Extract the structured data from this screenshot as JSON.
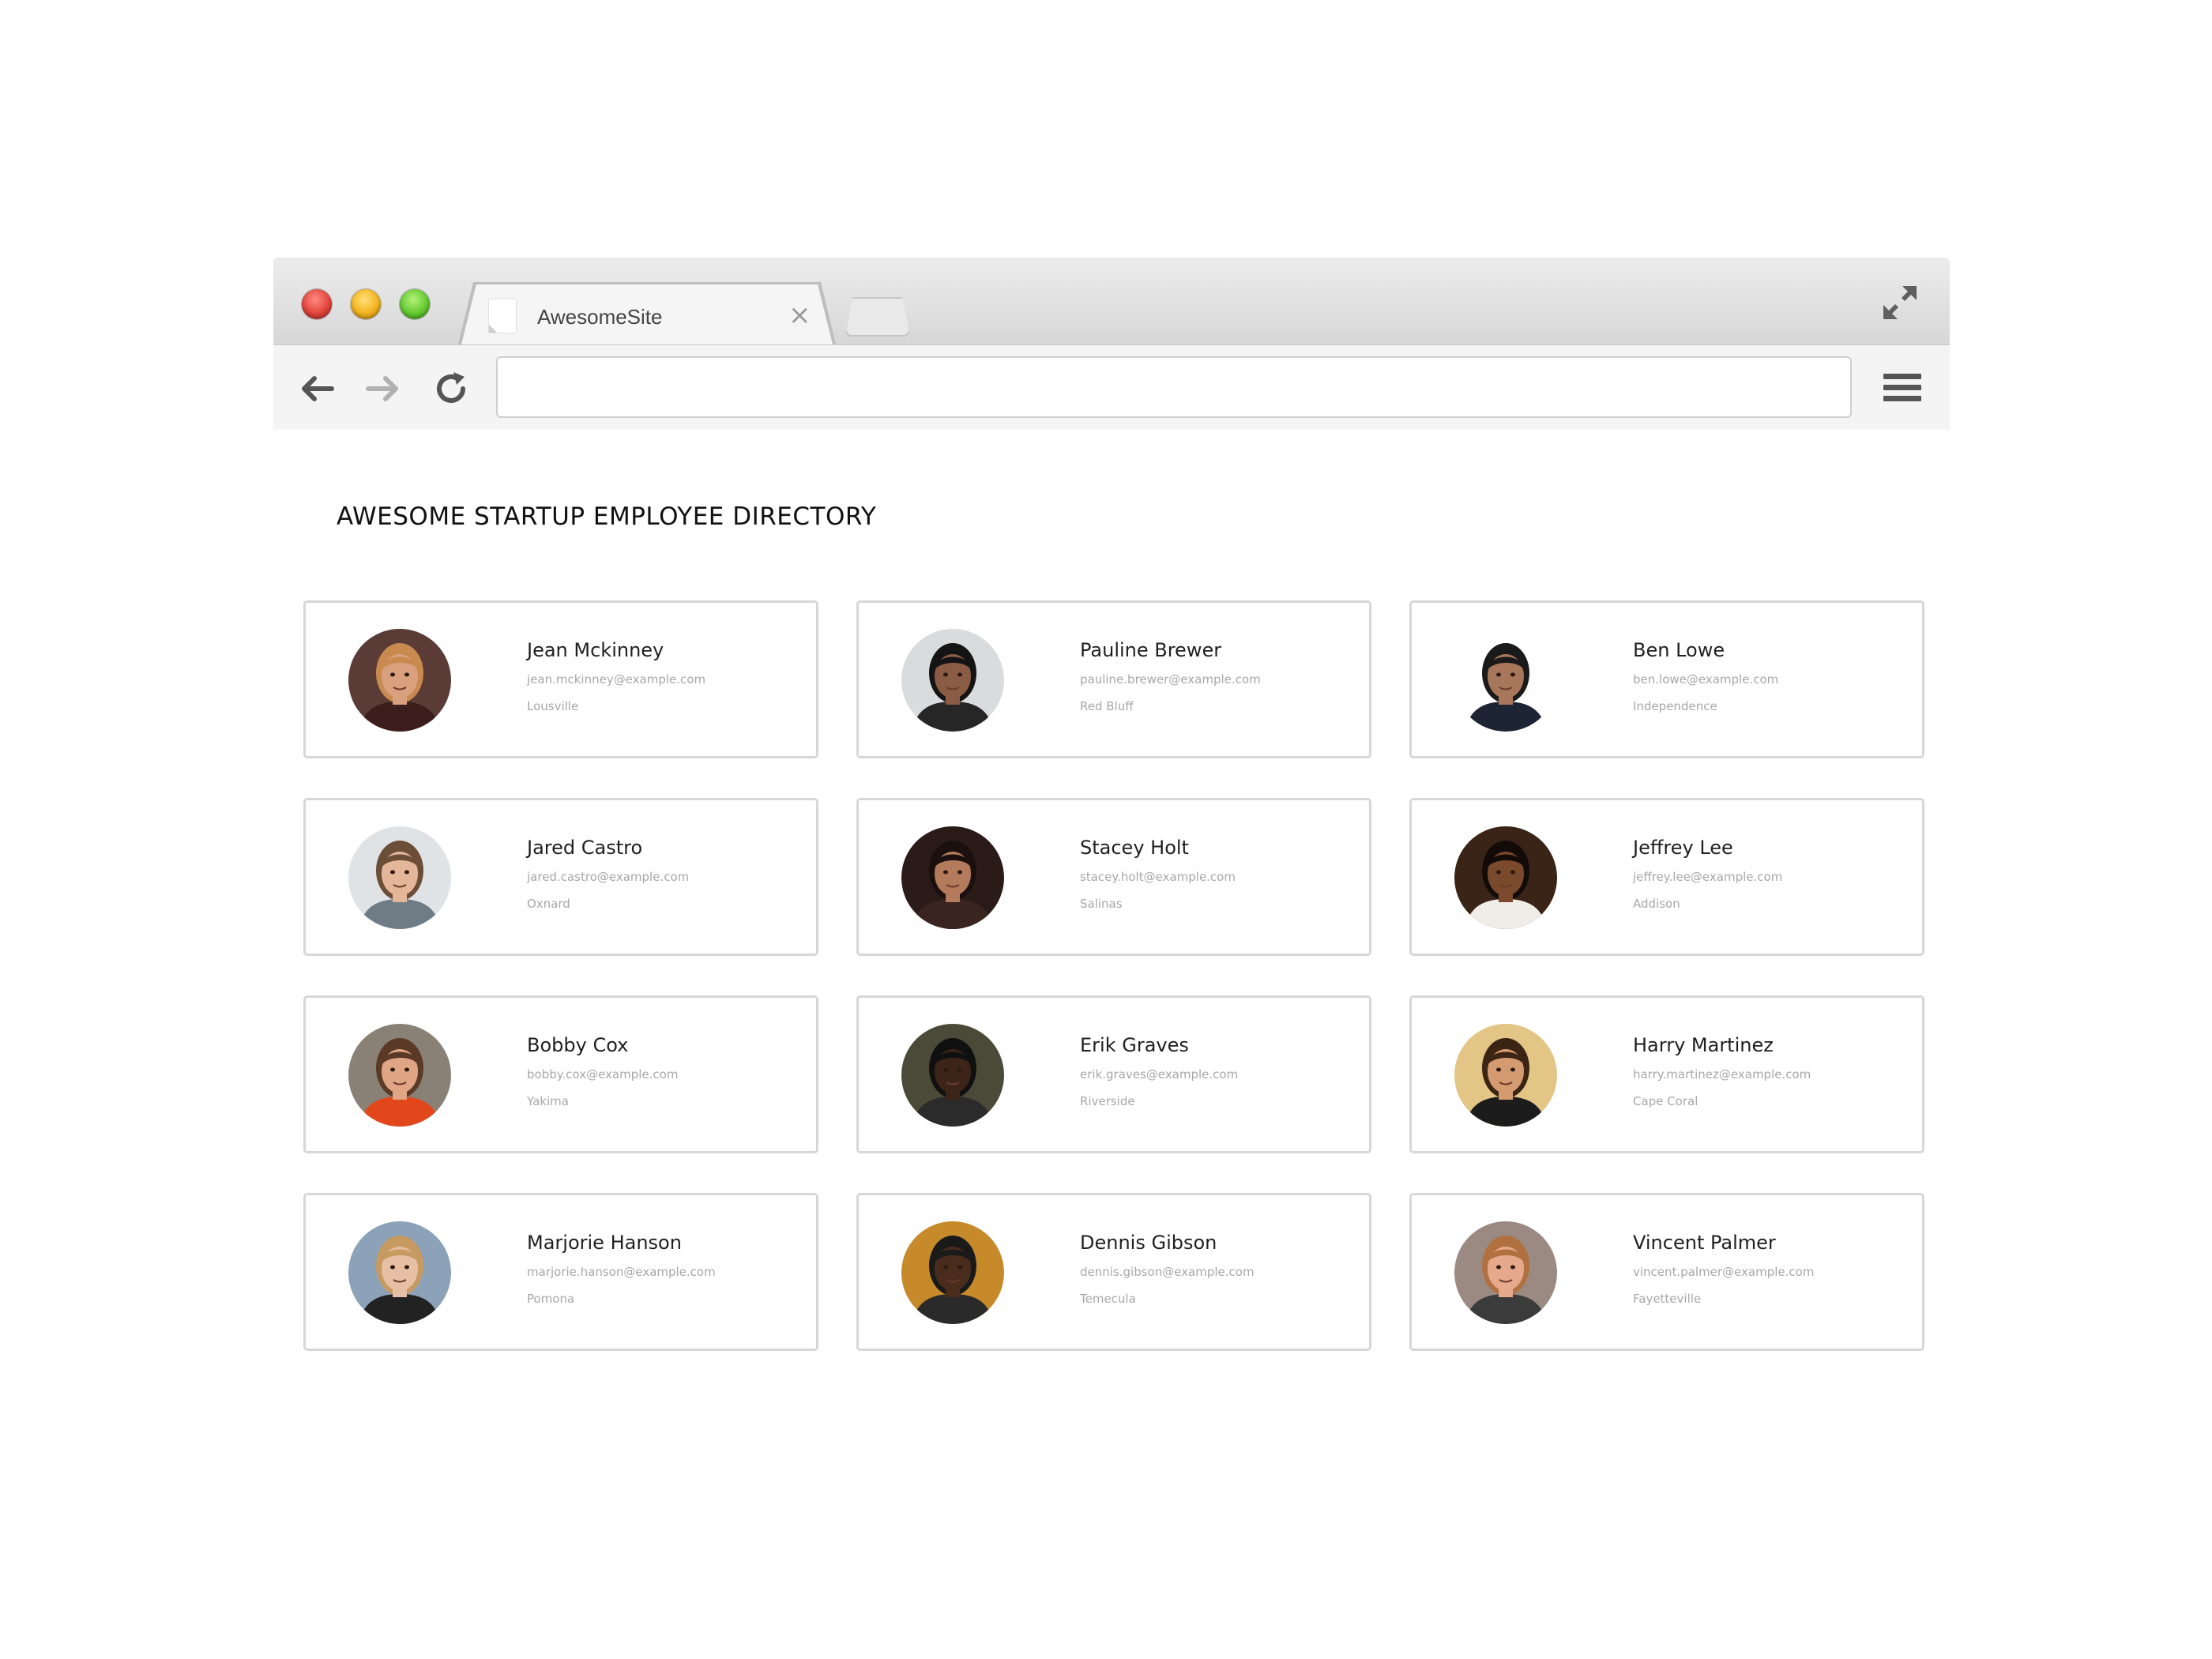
{
  "browser": {
    "tab_title": "AwesomeSite",
    "tab_close_glyph": "×",
    "address_value": "",
    "icons": {
      "back": "arrow-left-icon",
      "forward": "arrow-right-icon",
      "reload": "reload-icon",
      "menu": "hamburger-menu-icon",
      "fullscreen": "fullscreen-icon"
    },
    "colors": {
      "close": "#e0443a",
      "minimize": "#f2b21b",
      "zoom": "#62c930"
    }
  },
  "directory": {
    "title": "AWESOME STARTUP EMPLOYEE DIRECTORY",
    "employees": [
      {
        "name": "Jean Mckinney",
        "email": "jean.mckinney@example.com",
        "city": "Lousville",
        "avatar_bg": "#5a3b36",
        "avatar_skin": "#d9a07d",
        "avatar_hair": "#c98a50",
        "avatar_shirt": "#3b1e1b"
      },
      {
        "name": "Pauline Brewer",
        "email": "pauline.brewer@example.com",
        "city": "Red Bluff",
        "avatar_bg": "#d9dcdc",
        "avatar_skin": "#8a5b45",
        "avatar_hair": "#141414",
        "avatar_shirt": "#262626"
      },
      {
        "name": "Ben Lowe",
        "email": "ben.lowe@example.com",
        "city": "Independence",
        "avatar_bg": "#ffffff",
        "avatar_skin": "#a8765a",
        "avatar_hair": "#1a1a1a",
        "avatar_shirt": "#1d2434"
      },
      {
        "name": "Jared Castro",
        "email": "jared.castro@example.com",
        "city": "Oxnard",
        "avatar_bg": "#dfe3e6",
        "avatar_skin": "#e4b79b",
        "avatar_hair": "#6c4d38",
        "avatar_shirt": "#6f7c86"
      },
      {
        "name": "Stacey Holt",
        "email": "stacey.holt@example.com",
        "city": "Salinas",
        "avatar_bg": "#2a1b19",
        "avatar_skin": "#b37a5c",
        "avatar_hair": "#1b100e",
        "avatar_shirt": "#3a2420"
      },
      {
        "name": "Jeffrey Lee",
        "email": "jeffrey.lee@example.com",
        "city": "Addison",
        "avatar_bg": "#3a2417",
        "avatar_skin": "#7b4a2c",
        "avatar_hair": "#120b08",
        "avatar_shirt": "#f0ede8"
      },
      {
        "name": "Bobby Cox",
        "email": "bobby.cox@example.com",
        "city": "Yakima",
        "avatar_bg": "#8a8176",
        "avatar_skin": "#e0a585",
        "avatar_hair": "#5a3a26",
        "avatar_shirt": "#e2471b"
      },
      {
        "name": "Erik Graves",
        "email": "erik.graves@example.com",
        "city": "Riverside",
        "avatar_bg": "#4b4a38",
        "avatar_skin": "#3c2418",
        "avatar_hair": "#101010",
        "avatar_shirt": "#2b2b2b"
      },
      {
        "name": "Harry Martinez",
        "email": "harry.martinez@example.com",
        "city": "Cape Coral",
        "avatar_bg": "#e3c685",
        "avatar_skin": "#d49a70",
        "avatar_hair": "#3b2413",
        "avatar_shirt": "#1c1c1c"
      },
      {
        "name": "Marjorie Hanson",
        "email": "marjorie.hanson@example.com",
        "city": "Pomona",
        "avatar_bg": "#8ba2b8",
        "avatar_skin": "#e6bfa4",
        "avatar_hair": "#c79a62",
        "avatar_shirt": "#222222"
      },
      {
        "name": "Dennis Gibson",
        "email": "dennis.gibson@example.com",
        "city": "Temecula",
        "avatar_bg": "#c78a2a",
        "avatar_skin": "#4a2c1c",
        "avatar_hair": "#1a1a1a",
        "avatar_shirt": "#2a2a2a"
      },
      {
        "name": "Vincent Palmer",
        "email": "vincent.palmer@example.com",
        "city": "Fayetteville",
        "avatar_bg": "#9a8a82",
        "avatar_skin": "#e7a98c",
        "avatar_hair": "#b0703f",
        "avatar_shirt": "#3b3b3b"
      }
    ]
  }
}
